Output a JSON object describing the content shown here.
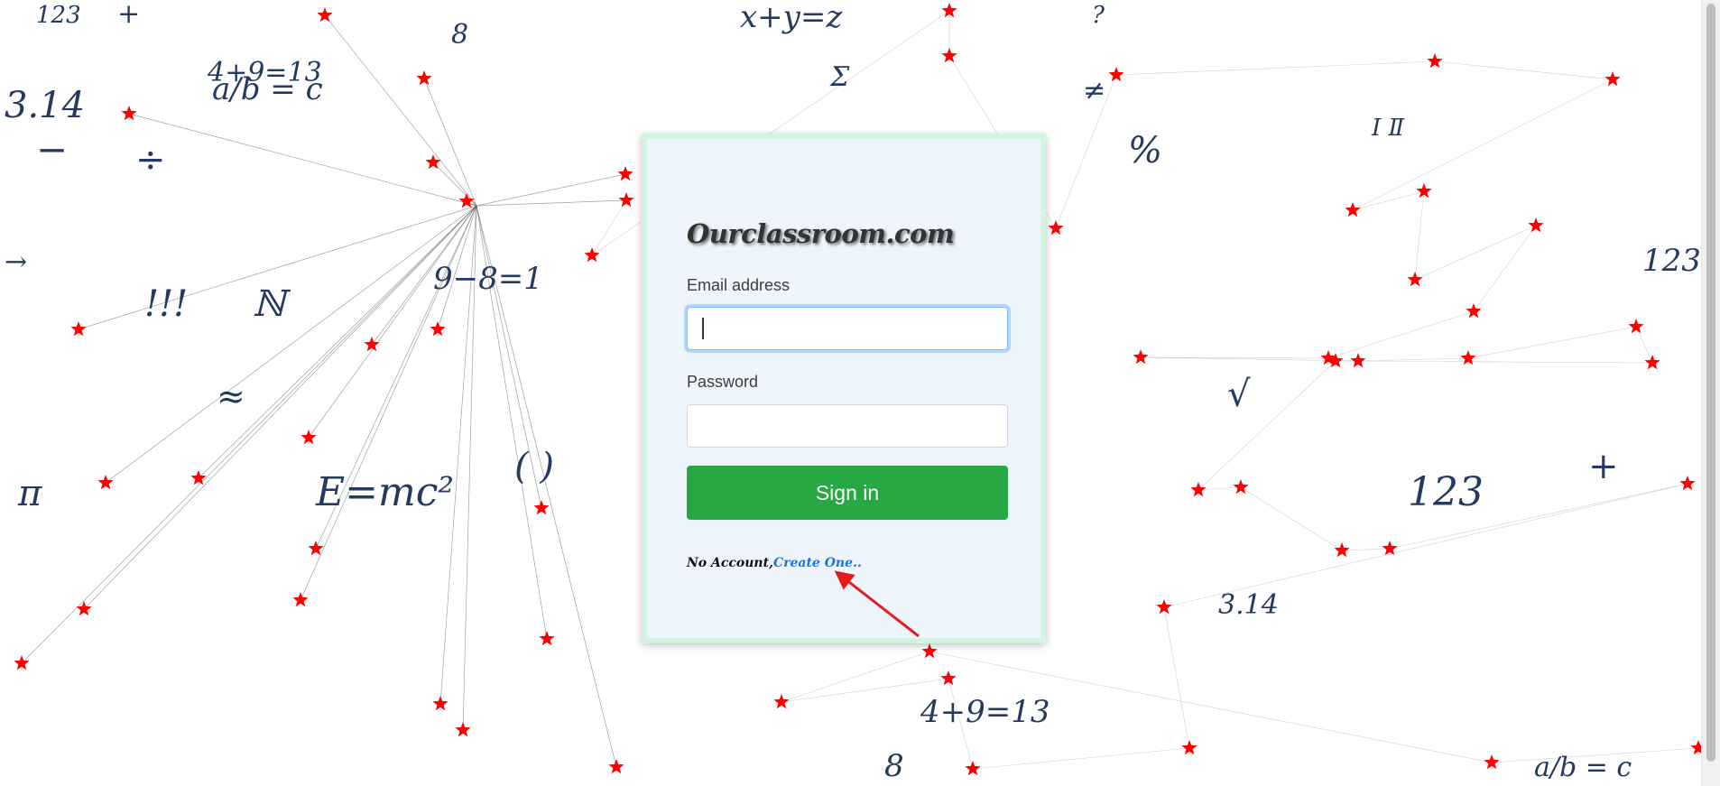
{
  "brand": "Ourclassroom.com",
  "form": {
    "email_label": "Email address",
    "email_value": "",
    "password_label": "Password",
    "password_value": "",
    "submit_label": "Sign in"
  },
  "signup": {
    "prompt": "No Account,",
    "link_label": "Create One.."
  },
  "colors": {
    "card_bg": "#eef5fd",
    "card_border": "#d3f5df",
    "button": "#28a745",
    "link": "#1a73e8",
    "star": "#ff0000",
    "doodle_ink": "#243a5e"
  },
  "background_doodles": [
    "123",
    "+",
    "3.14",
    "a/b = c",
    "4+9=13",
    "8",
    "−",
    "÷",
    "→",
    "!!!",
    "ℕ",
    "≈",
    "π",
    "E=mc²",
    "( )",
    "9−8=1",
    "Σ",
    "x+y=z",
    "?",
    "≠",
    "%",
    "Ⅰ Ⅱ",
    "123",
    "√"
  ]
}
